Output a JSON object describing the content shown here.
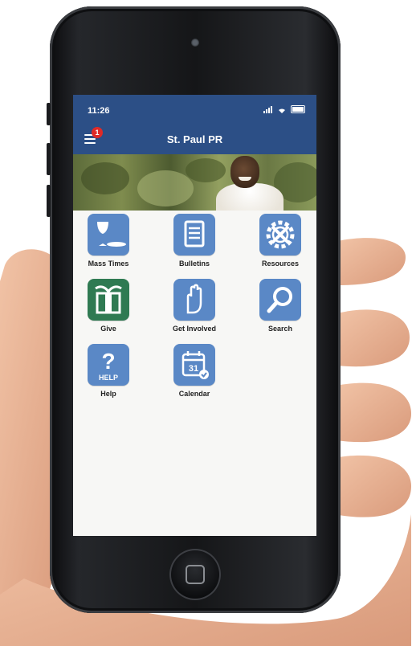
{
  "status_bar": {
    "time": "11:26"
  },
  "header": {
    "title": "St. Paul PR",
    "notification_count": "1"
  },
  "tiles": [
    {
      "label": "Mass Times",
      "icon": "chalice-icon"
    },
    {
      "label": "Bulletins",
      "icon": "document-icon"
    },
    {
      "label": "Resources",
      "icon": "gear-tools-icon"
    },
    {
      "label": "Give",
      "icon": "gift-icon"
    },
    {
      "label": "Get Involved",
      "icon": "raised-hand-icon"
    },
    {
      "label": "Search",
      "icon": "magnifier-icon"
    },
    {
      "label": "Help",
      "icon": "help-icon",
      "icon_text": "HELP"
    },
    {
      "label": "Calendar",
      "icon": "calendar-icon",
      "icon_text": "31"
    }
  ],
  "colors": {
    "header": "#2c4f86",
    "tile": "#5a88c6",
    "give_tile": "#2f7a52",
    "badge": "#e02a27"
  }
}
